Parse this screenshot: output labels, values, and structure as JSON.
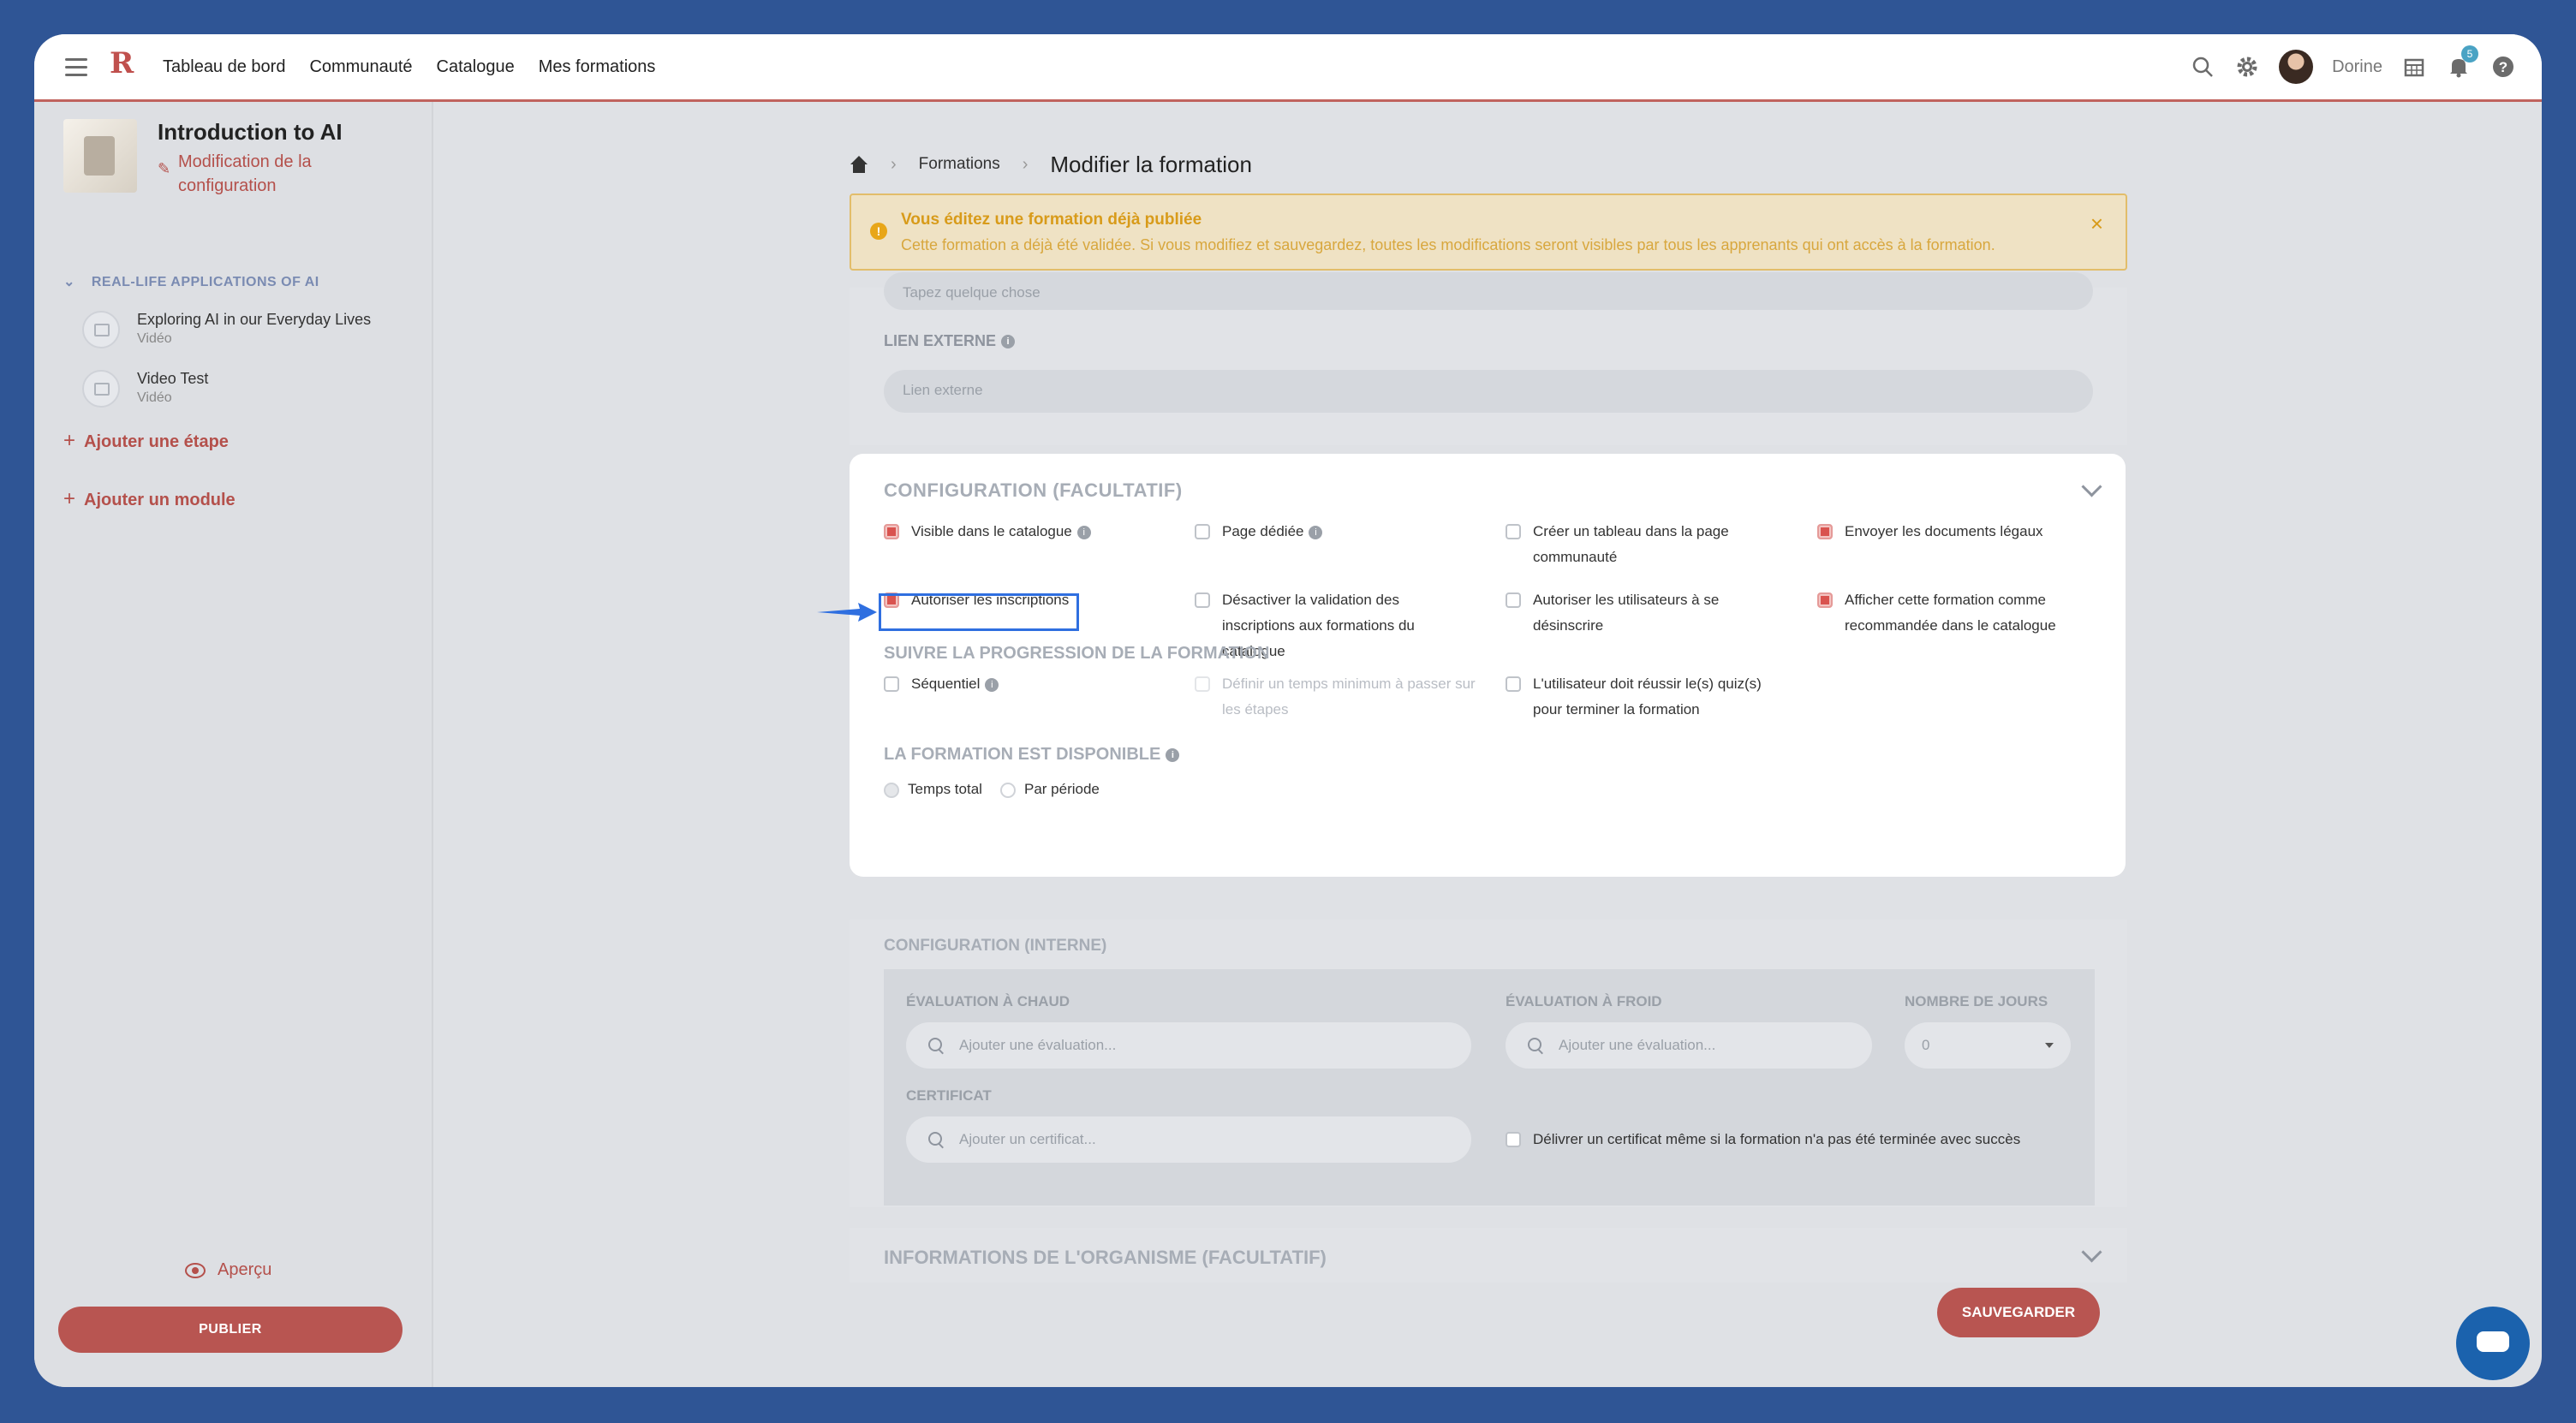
{
  "nav": {
    "items": [
      "Tableau de bord",
      "Communauté",
      "Catalogue",
      "Mes formations"
    ],
    "logo": "R",
    "user_name": "Dorine",
    "notification_count": "5"
  },
  "sidebar": {
    "course_title": "Introduction to AI",
    "edit_config": "Modification de la configuration",
    "module_title": "REAL-LIFE APPLICATIONS OF AI",
    "steps": [
      {
        "title": "Exploring AI in our Everyday Lives",
        "type": "Vidéo"
      },
      {
        "title": "Video Test",
        "type": "Vidéo"
      }
    ],
    "add_step": "Ajouter une étape",
    "add_module": "Ajouter un module",
    "preview": "Aperçu",
    "publish": "PUBLIER"
  },
  "breadcrumb": {
    "link": "Formations",
    "current": "Modifier la formation"
  },
  "alert": {
    "title": "Vous éditez une formation déjà publiée",
    "text": "Cette formation a déjà été validée. Si vous modifiez et sauvegardez, toutes les modifications seront visibles par tous les apprenants qui ont accès à la formation."
  },
  "top_fields": {
    "partial_placeholder": "Tapez quelque chose",
    "external_link_label": "LIEN EXTERNE",
    "external_link_placeholder": "Lien externe"
  },
  "config": {
    "title": "CONFIGURATION (FACULTATIF)",
    "options": [
      {
        "label": "Visible dans le catalogue",
        "checked": true
      },
      {
        "label": "Page dédiée",
        "checked": false
      },
      {
        "label": "Créer un tableau dans la page communauté",
        "checked": false
      },
      {
        "label": "Envoyer les documents légaux",
        "checked": true
      },
      {
        "label": "Autoriser les inscriptions",
        "checked": true
      },
      {
        "label": "Désactiver la validation des inscriptions aux formations du catalogue",
        "checked": false
      },
      {
        "label": "Autoriser les utilisateurs à se désinscrire",
        "checked": false
      },
      {
        "label": "Afficher cette formation comme recommandée dans le catalogue",
        "checked": true
      }
    ],
    "progress_title": "SUIVRE LA PROGRESSION DE LA FORMATION",
    "progress_options": [
      {
        "label": "Séquentiel",
        "checked": false
      },
      {
        "label": "Définir un temps minimum à passer sur les étapes",
        "checked": false
      },
      {
        "label": "L'utilisateur doit réussir le(s) quiz(s) pour terminer la formation",
        "checked": false
      }
    ],
    "availability_title": "LA FORMATION EST DISPONIBLE",
    "radios": [
      {
        "label": "Temps total",
        "selected": true
      },
      {
        "label": "Par période",
        "selected": false
      }
    ]
  },
  "internal": {
    "title": "CONFIGURATION (INTERNE)",
    "hot_eval_label": "ÉVALUATION À CHAUD",
    "hot_eval_placeholder": "Ajouter une évaluation...",
    "cold_eval_label": "ÉVALUATION À FROID",
    "cold_eval_placeholder": "Ajouter une évaluation...",
    "days_label": "NOMBRE DE JOURS",
    "days_value": "0",
    "certificate_label": "CERTIFICAT",
    "certificate_placeholder": "Ajouter un certificat...",
    "certificate_option": "Délivrer un certificat même si la formation n'a pas été terminée avec succès"
  },
  "org": {
    "title": "INFORMATIONS DE L'ORGANISME (FACULTATIF)"
  },
  "save": "SAUVEGARDER",
  "colors": {
    "accent": "#b85551",
    "highlight": "#2f6fe0",
    "alert_bg": "#efe2c4"
  }
}
